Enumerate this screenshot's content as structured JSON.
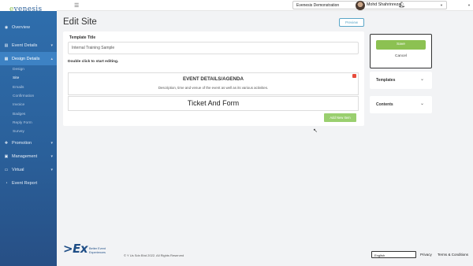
{
  "app": {
    "logo": "evenesis"
  },
  "topbar": {
    "event": "Evenesis Demonstration",
    "user": "Mohd Shahrinrezal"
  },
  "sidebar": {
    "items": [
      {
        "label": "Overview",
        "icon": "overview-icon"
      },
      {
        "label": "Event Details",
        "icon": "info-icon"
      },
      {
        "label": "Design Details",
        "icon": "design-icon"
      }
    ],
    "sub_items": [
      "Design",
      "Site",
      "Emails",
      "Confirmation",
      "Invoice",
      "Badges",
      "Reply Form",
      "Survey"
    ],
    "lower_items": [
      {
        "label": "Promotion",
        "icon": "promotion-icon"
      },
      {
        "label": "Management",
        "icon": "management-icon"
      },
      {
        "label": "Virtual",
        "icon": "virtual-icon"
      },
      {
        "label": "Event Report",
        "icon": "report-icon"
      }
    ]
  },
  "page": {
    "title": "Edit Site",
    "preview": "Preview"
  },
  "form": {
    "template_title_label": "Template Title",
    "template_title_value": "Internal Training Sample",
    "hint": "Double click to start editing.",
    "block1_title": "EVENT DETAILS/AGENDA",
    "block1_desc": "Description, time and venue of the event as well as its various activities.",
    "block2_title": "Ticket And Form",
    "add_button": "Add New Item"
  },
  "right_panel": {
    "save": "Save",
    "cancel": "Cancel",
    "templates": "Templates",
    "contents": "Contents"
  },
  "footer": {
    "logo": ">Ex",
    "tagline_1": "Better Event",
    "tagline_2": "Experiences",
    "copyright": "© Y Us Sdn Bhd 2022. All Rights Reserved",
    "language": "English",
    "privacy": "Privacy",
    "terms": "Terms & Conditions"
  },
  "colors": {
    "sidebar": "#2a5f99",
    "accent_green": "#8cc152",
    "active_nav": "#3d82c4"
  }
}
